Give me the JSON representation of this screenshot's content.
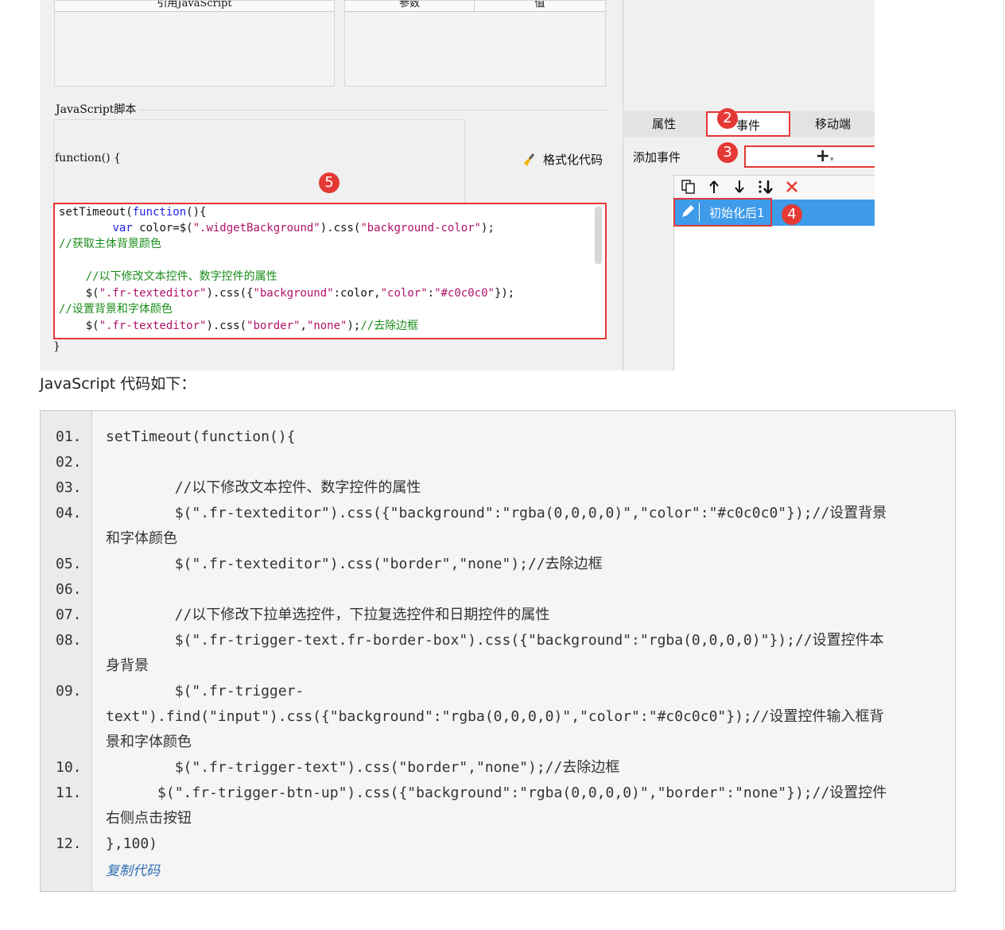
{
  "ref_panel": {
    "ref_js_header": "引用JavaScript",
    "param_header": "参数",
    "value_header": "值"
  },
  "script_section": {
    "label": "JavaScript脚本",
    "func_open": "function() {",
    "func_close": "}",
    "format_button": "格式化代码"
  },
  "editor_lines": {
    "l1": "setTimeout(",
    "l1b": "function",
    "l1c": "(){",
    "l2a": "        ",
    "l2kw": "var",
    "l2b": " color=$(",
    "l2s1": "\".widgetBackground\"",
    "l2c": ").css(",
    "l2s2": "\"background-color\"",
    "l2d": ");",
    "l3": "//获取主体背景颜色",
    "l5": "    //以下修改文本控件、数字控件的属性",
    "l6a": "    $(",
    "l6s1": "\".fr-texteditor\"",
    "l6b": ").css({",
    "l6s2": "\"background\"",
    "l6c": ":color,",
    "l6s3": "\"color\"",
    "l6d": ":",
    "l6s4": "\"#c0c0c0\"",
    "l6e": "});",
    "l7": "//设置背景和字体颜色",
    "l8a": "    $(",
    "l8s1": "\".fr-texteditor\"",
    "l8b": ").css(",
    "l8s2": "\"border\"",
    "l8c": ",",
    "l8s3": "\"none\"",
    "l8d": ");",
    "l8cm": "//去除边框"
  },
  "right_panel": {
    "tabs": [
      "属性",
      "事件",
      "移动端"
    ],
    "add_event_label": "添加事件",
    "add_button": "+",
    "event_item": "初始化后1"
  },
  "badges": [
    "2",
    "3",
    "4",
    "5"
  ],
  "caption": "JavaScript 代码如下：",
  "code_block": {
    "line_numbers": [
      "01.",
      "02.",
      "03.",
      "04.",
      "",
      "05.",
      "06.",
      "07.",
      "08.",
      "",
      "09.",
      "",
      "",
      "10.",
      "11.",
      "",
      "12."
    ],
    "lines": [
      "setTimeout(function(){",
      "",
      "        //以下修改文本控件、数字控件的属性",
      "        $(\".fr-texteditor\").css({\"background\":\"rgba(0,0,0,0)\",\"color\":\"#c0c0c0\"});//设置背景",
      "和字体颜色",
      "        $(\".fr-texteditor\").css(\"border\",\"none\");//去除边框",
      "",
      "        //以下修改下拉单选控件，下拉复选控件和日期控件的属性",
      "        $(\".fr-trigger-text.fr-border-box\").css({\"background\":\"rgba(0,0,0,0)\"});//设置控件本",
      "身背景",
      "        $(\".fr-trigger-",
      "text\").find(\"input\").css({\"background\":\"rgba(0,0,0,0)\",\"color\":\"#c0c0c0\"});//设置控件输入框背",
      "景和字体颜色",
      "        $(\".fr-trigger-text\").css(\"border\",\"none\");//去除边框",
      "      $(\".fr-trigger-btn-up\").css({\"background\":\"rgba(0,0,0,0)\",\"border\":\"none\"});//设置控件",
      "右侧点击按钮",
      "},100)"
    ],
    "copy_label": "复制代码"
  },
  "colors": {
    "highlight_red": "#e53935",
    "selection_blue": "#3d9be9",
    "comment_green": "#1a8c1a",
    "keyword_blue": "#1e1ef0",
    "string_magenta": "#b0126a"
  }
}
